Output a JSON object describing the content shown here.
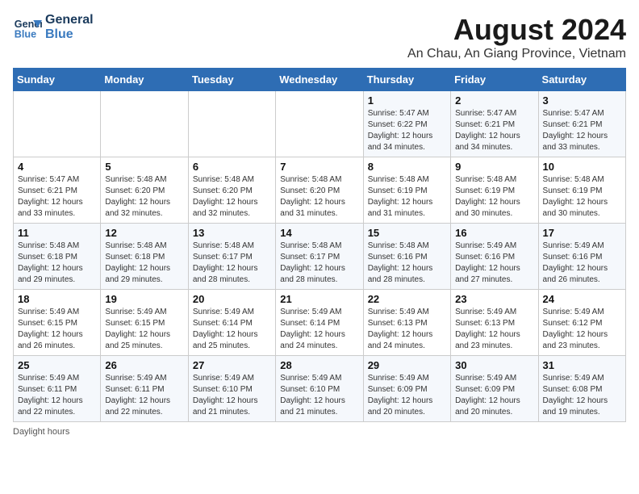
{
  "header": {
    "logo_line1": "General",
    "logo_line2": "Blue",
    "month": "August 2024",
    "location": "An Chau, An Giang Province, Vietnam"
  },
  "weekdays": [
    "Sunday",
    "Monday",
    "Tuesday",
    "Wednesday",
    "Thursday",
    "Friday",
    "Saturday"
  ],
  "weeks": [
    [
      {
        "day": "",
        "content": ""
      },
      {
        "day": "",
        "content": ""
      },
      {
        "day": "",
        "content": ""
      },
      {
        "day": "",
        "content": ""
      },
      {
        "day": "1",
        "content": "Sunrise: 5:47 AM\nSunset: 6:22 PM\nDaylight: 12 hours and 34 minutes."
      },
      {
        "day": "2",
        "content": "Sunrise: 5:47 AM\nSunset: 6:21 PM\nDaylight: 12 hours and 34 minutes."
      },
      {
        "day": "3",
        "content": "Sunrise: 5:47 AM\nSunset: 6:21 PM\nDaylight: 12 hours and 33 minutes."
      }
    ],
    [
      {
        "day": "4",
        "content": "Sunrise: 5:47 AM\nSunset: 6:21 PM\nDaylight: 12 hours and 33 minutes."
      },
      {
        "day": "5",
        "content": "Sunrise: 5:48 AM\nSunset: 6:20 PM\nDaylight: 12 hours and 32 minutes."
      },
      {
        "day": "6",
        "content": "Sunrise: 5:48 AM\nSunset: 6:20 PM\nDaylight: 12 hours and 32 minutes."
      },
      {
        "day": "7",
        "content": "Sunrise: 5:48 AM\nSunset: 6:20 PM\nDaylight: 12 hours and 31 minutes."
      },
      {
        "day": "8",
        "content": "Sunrise: 5:48 AM\nSunset: 6:19 PM\nDaylight: 12 hours and 31 minutes."
      },
      {
        "day": "9",
        "content": "Sunrise: 5:48 AM\nSunset: 6:19 PM\nDaylight: 12 hours and 30 minutes."
      },
      {
        "day": "10",
        "content": "Sunrise: 5:48 AM\nSunset: 6:19 PM\nDaylight: 12 hours and 30 minutes."
      }
    ],
    [
      {
        "day": "11",
        "content": "Sunrise: 5:48 AM\nSunset: 6:18 PM\nDaylight: 12 hours and 29 minutes."
      },
      {
        "day": "12",
        "content": "Sunrise: 5:48 AM\nSunset: 6:18 PM\nDaylight: 12 hours and 29 minutes."
      },
      {
        "day": "13",
        "content": "Sunrise: 5:48 AM\nSunset: 6:17 PM\nDaylight: 12 hours and 28 minutes."
      },
      {
        "day": "14",
        "content": "Sunrise: 5:48 AM\nSunset: 6:17 PM\nDaylight: 12 hours and 28 minutes."
      },
      {
        "day": "15",
        "content": "Sunrise: 5:48 AM\nSunset: 6:16 PM\nDaylight: 12 hours and 28 minutes."
      },
      {
        "day": "16",
        "content": "Sunrise: 5:49 AM\nSunset: 6:16 PM\nDaylight: 12 hours and 27 minutes."
      },
      {
        "day": "17",
        "content": "Sunrise: 5:49 AM\nSunset: 6:16 PM\nDaylight: 12 hours and 26 minutes."
      }
    ],
    [
      {
        "day": "18",
        "content": "Sunrise: 5:49 AM\nSunset: 6:15 PM\nDaylight: 12 hours and 26 minutes."
      },
      {
        "day": "19",
        "content": "Sunrise: 5:49 AM\nSunset: 6:15 PM\nDaylight: 12 hours and 25 minutes."
      },
      {
        "day": "20",
        "content": "Sunrise: 5:49 AM\nSunset: 6:14 PM\nDaylight: 12 hours and 25 minutes."
      },
      {
        "day": "21",
        "content": "Sunrise: 5:49 AM\nSunset: 6:14 PM\nDaylight: 12 hours and 24 minutes."
      },
      {
        "day": "22",
        "content": "Sunrise: 5:49 AM\nSunset: 6:13 PM\nDaylight: 12 hours and 24 minutes."
      },
      {
        "day": "23",
        "content": "Sunrise: 5:49 AM\nSunset: 6:13 PM\nDaylight: 12 hours and 23 minutes."
      },
      {
        "day": "24",
        "content": "Sunrise: 5:49 AM\nSunset: 6:12 PM\nDaylight: 12 hours and 23 minutes."
      }
    ],
    [
      {
        "day": "25",
        "content": "Sunrise: 5:49 AM\nSunset: 6:11 PM\nDaylight: 12 hours and 22 minutes."
      },
      {
        "day": "26",
        "content": "Sunrise: 5:49 AM\nSunset: 6:11 PM\nDaylight: 12 hours and 22 minutes."
      },
      {
        "day": "27",
        "content": "Sunrise: 5:49 AM\nSunset: 6:10 PM\nDaylight: 12 hours and 21 minutes."
      },
      {
        "day": "28",
        "content": "Sunrise: 5:49 AM\nSunset: 6:10 PM\nDaylight: 12 hours and 21 minutes."
      },
      {
        "day": "29",
        "content": "Sunrise: 5:49 AM\nSunset: 6:09 PM\nDaylight: 12 hours and 20 minutes."
      },
      {
        "day": "30",
        "content": "Sunrise: 5:49 AM\nSunset: 6:09 PM\nDaylight: 12 hours and 20 minutes."
      },
      {
        "day": "31",
        "content": "Sunrise: 5:49 AM\nSunset: 6:08 PM\nDaylight: 12 hours and 19 minutes."
      }
    ]
  ],
  "footer": {
    "daylight_label": "Daylight hours"
  }
}
